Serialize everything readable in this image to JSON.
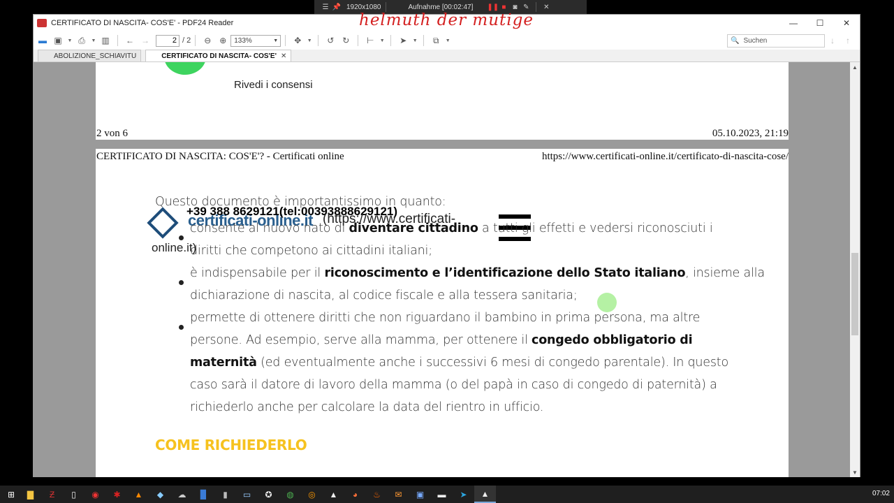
{
  "recorder": {
    "resolution": "1920x1080",
    "status": "Aufnahme [00:02:47]"
  },
  "signature_text": "helmuth der mutige",
  "window": {
    "title": "CERTIFICATO DI NASCITA- COS'E' - PDF24 Reader",
    "controls": {
      "minimize": "—",
      "maximize": "☐",
      "close": "✕"
    }
  },
  "toolbar": {
    "page_current": "2",
    "page_total": "/ 2",
    "zoom": "133%",
    "search_placeholder": "Suchen"
  },
  "tabs": [
    {
      "label": "ABOLIZIONE_SCHIAVITU",
      "active": false
    },
    {
      "label": "CERTIFICATO DI NASCITA- COS'E'",
      "active": true
    }
  ],
  "page1": {
    "consent_link": "Rivedi i consensi",
    "footer_left": "2 von 6",
    "footer_right": "05.10.2023, 21:19"
  },
  "page2": {
    "header_left": "CERTIFICATO DI NASCITA: COS'E'? - Certificati online",
    "header_right": "https://www.certificati-online.it/certificato-di-nascita-cose/",
    "intro": "Questo documento è importantissimo in quanto:",
    "overlay": {
      "phone": "+39 388 8629121(tel:00393888629121)",
      "site_name": "certificati-online.it",
      "url_part1": "(https://www.certificati-",
      "url_part2": "online.it)"
    },
    "bullets": [
      {
        "l1a": "consente al nuovo nato di ",
        "l1b": "diventare cittadino",
        "l1c": " a tutti gli effetti e vedersi riconosciuti i",
        "l2": "diritti che competono ai cittadini italiani;"
      },
      {
        "l1a": "è indispensabile per il ",
        "l1b": "riconoscimento e l’identificazione dello Stato italiano",
        "l1c": ", insieme alla",
        "l2": "dichiarazione di nascita, al codice fiscale e alla tessera sanitaria;"
      },
      {
        "l1": "permette di ottenere diritti che non riguardano il bambino in prima persona, ma altre",
        "l2a": "persone. Ad esempio, serve alla mamma, per ottenere il ",
        "l2b": "congedo obbligatorio di",
        "l3a": "maternità",
        "l3b": " (ed eventualmente anche i successivi 6 mesi di congedo parentale). In questo",
        "l4": "caso sarà il datore di lavoro della mamma (o del papà in caso di congedo di paternità) a",
        "l5": "richiederlo anche per calcolare la data del rientro in ufficio."
      }
    ],
    "section_heading": "COME RICHIEDERLO"
  },
  "taskbar": {
    "icons": [
      "explorer-icon",
      "filezilla-icon",
      "file-icon",
      "record-icon",
      "app-icon",
      "vlc-icon",
      "app-icon",
      "app-icon",
      "word-icon",
      "usb-icon",
      "browser-icon",
      "game-icon",
      "chrome-icon",
      "thunderbird-icon",
      "pyramid-icon",
      "firefox-icon",
      "app-icon",
      "outlook-icon",
      "save-icon",
      "terminal-icon",
      "telegram-icon",
      "pdf24-icon"
    ],
    "clock": "07:02"
  }
}
